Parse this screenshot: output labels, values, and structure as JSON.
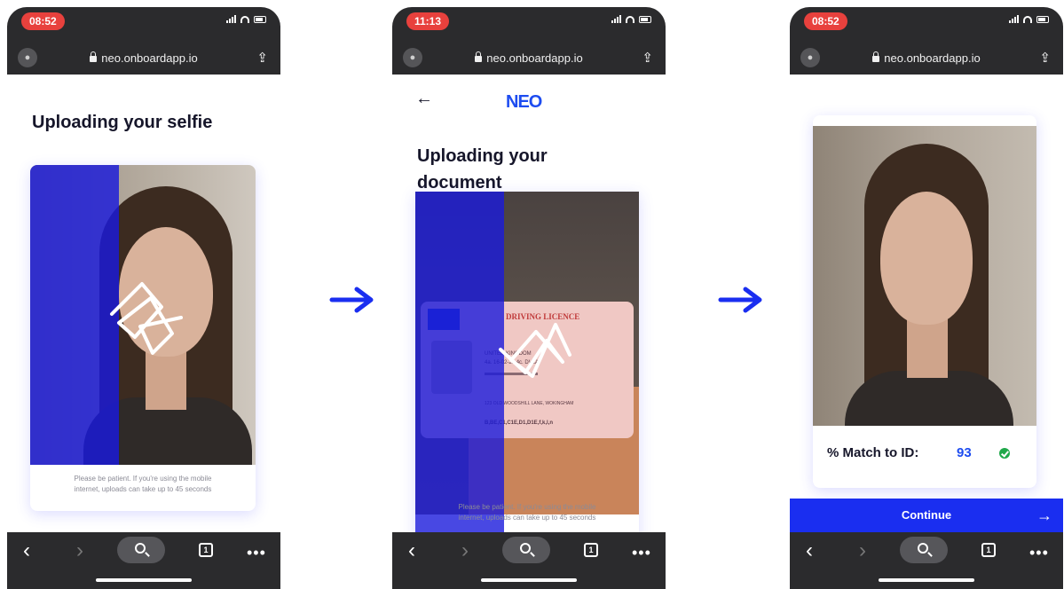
{
  "phones": [
    {
      "time": "08:52",
      "url": "neo.onboardapp.io",
      "title": "Uploading your selfie",
      "hint_line1": "Please be patient. If you're using the mobile",
      "hint_line2": "internet, uploads can take up to 45 seconds"
    },
    {
      "time": "11:13",
      "url": "neo.onboardapp.io",
      "logo": "NEO",
      "title_line1": "Uploading your",
      "title_line2": "document",
      "licence_title": "DRIVING LICENCE",
      "licence_country": "UNITED KINGDOM",
      "licence_issue": "4a. 16-02-21  4c. DVLA",
      "licence_address": "123 OLD WOODSHILL LANE, WOKINGHAM",
      "licence_categories": "B,BE,C1,C1E,D1,D1E,f,k,l,n",
      "hint_line1": "Please be patient. If you're using the mobile",
      "hint_line2": "internet, uploads can take up to 45 seconds"
    },
    {
      "time": "08:52",
      "url": "neo.onboardapp.io",
      "match_label": "% Match to ID:",
      "match_value": "93",
      "continue_label": "Continue"
    }
  ],
  "toolbar": {
    "tabs_count": "1"
  },
  "colors": {
    "accent": "#1a2ef0",
    "time_pill": "#e8413d",
    "success": "#1fa84a"
  }
}
